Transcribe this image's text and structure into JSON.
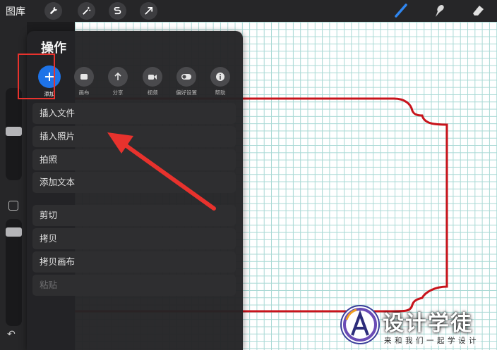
{
  "topbar": {
    "gallery_label": "图库",
    "tools_left": [
      "wrench-icon",
      "magic-wand-icon",
      "selection-icon",
      "transform-arrow-icon"
    ],
    "tools_right": [
      "brush-icon",
      "smudge-icon",
      "eraser-icon"
    ],
    "accent": "#1e73e8"
  },
  "panel": {
    "title": "操作",
    "tabs": [
      {
        "label": "添加",
        "icon": "plus-icon"
      },
      {
        "label": "画布",
        "icon": "canvas-icon"
      },
      {
        "label": "分享",
        "icon": "share-icon"
      },
      {
        "label": "视频",
        "icon": "video-icon"
      },
      {
        "label": "偏好设置",
        "icon": "toggle-icon"
      },
      {
        "label": "帮助",
        "icon": "info-icon"
      }
    ],
    "items": [
      "插入文件",
      "插入照片",
      "拍照",
      "添加文本",
      "剪切",
      "拷贝",
      "拷贝画布",
      "粘贴"
    ],
    "highlight_color": "#e8322d"
  },
  "sidebar": {
    "undo_icon": "undo-icon"
  },
  "watermark": {
    "title": "设计学徒",
    "subtitle": "来和我们一起学设计"
  },
  "canvas": {
    "frame_color": "#c8141c",
    "grid_color": "#a9d9d5"
  }
}
